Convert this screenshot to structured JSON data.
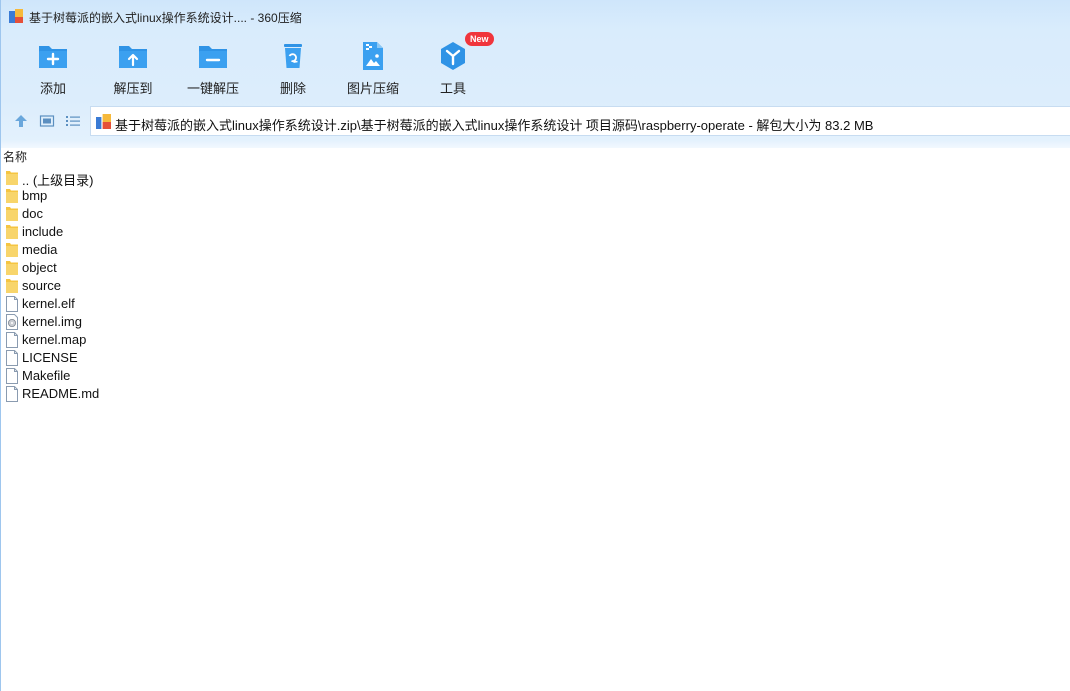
{
  "window": {
    "title": "基于树莓派的嵌入式linux操作系统设计.... - 360压缩"
  },
  "toolbar": {
    "items": [
      {
        "label": "添加",
        "icon": "add-folder-icon"
      },
      {
        "label": "解压到",
        "icon": "extract-to-icon"
      },
      {
        "label": "一键解压",
        "icon": "one-click-extract-icon"
      },
      {
        "label": "删除",
        "icon": "delete-icon"
      },
      {
        "label": "图片压缩",
        "icon": "image-compress-icon"
      },
      {
        "label": "工具",
        "icon": "tools-icon",
        "badge": "New"
      }
    ]
  },
  "nav": {
    "up_icon": "arrow-up-icon",
    "thumbnail_view_icon": "thumbnail-view-icon",
    "list_view_icon": "list-view-icon"
  },
  "address": {
    "path": "基于树莓派的嵌入式linux操作系统设计.zip\\基于树莓派的嵌入式linux操作系统设计 项目源码\\raspberry-operate - 解包大小为 83.2 MB"
  },
  "list": {
    "column_name": "名称",
    "items": [
      {
        "name": ".. (上级目录)",
        "type": "folder"
      },
      {
        "name": "bmp",
        "type": "folder"
      },
      {
        "name": "doc",
        "type": "folder"
      },
      {
        "name": "include",
        "type": "folder"
      },
      {
        "name": "media",
        "type": "folder"
      },
      {
        "name": "object",
        "type": "folder"
      },
      {
        "name": "source",
        "type": "folder"
      },
      {
        "name": "kernel.elf",
        "type": "file"
      },
      {
        "name": "kernel.img",
        "type": "disc-image"
      },
      {
        "name": "kernel.map",
        "type": "file"
      },
      {
        "name": "LICENSE",
        "type": "file"
      },
      {
        "name": "Makefile",
        "type": "file"
      },
      {
        "name": "README.md",
        "type": "file"
      }
    ]
  },
  "colors": {
    "accent_blue": "#2f93e6",
    "chrome_bg": "#d9ecfc",
    "badge_red": "#f0353c",
    "folder_yellow": "#f5c542"
  }
}
